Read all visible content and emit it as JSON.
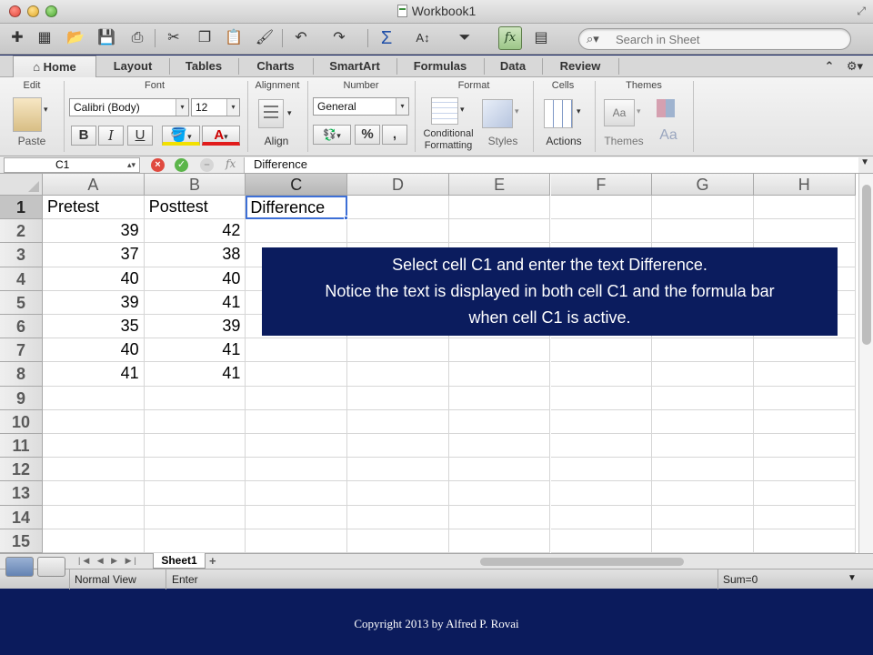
{
  "window": {
    "title": "Workbook1"
  },
  "search": {
    "placeholder": "Search in Sheet"
  },
  "tabs": [
    "Home",
    "Layout",
    "Tables",
    "Charts",
    "SmartArt",
    "Formulas",
    "Data",
    "Review"
  ],
  "ribbon": {
    "groups": [
      "Edit",
      "Font",
      "Alignment",
      "Number",
      "Format",
      "Cells",
      "Themes"
    ],
    "font_name": "Calibri (Body)",
    "font_size": "12",
    "number_format": "General",
    "paste_label": "Paste",
    "align_label": "Align",
    "conditional_formatting_label": "Conditional\nFormatting",
    "styles_label": "Styles",
    "actions_label": "Actions",
    "themes_label": "Themes",
    "bold": "B",
    "italic": "I",
    "underline": "U",
    "percent": "%",
    "comma": ","
  },
  "formula_bar": {
    "name_box": "C1",
    "fx": "fx",
    "content": "Difference"
  },
  "columns": [
    "A",
    "B",
    "C",
    "D",
    "E",
    "F",
    "G",
    "H"
  ],
  "rows": [
    "1",
    "2",
    "3",
    "4",
    "5",
    "6",
    "7",
    "8",
    "9",
    "10",
    "11",
    "12",
    "13",
    "14",
    "15"
  ],
  "cells": {
    "A1": "Pretest",
    "B1": "Posttest",
    "C1": "Difference",
    "A2": "39",
    "B2": "42",
    "A3": "37",
    "B3": "38",
    "A4": "40",
    "B4": "40",
    "A5": "39",
    "B5": "41",
    "A6": "35",
    "B6": "39",
    "A7": "40",
    "B7": "41",
    "A8": "41",
    "B8": "41"
  },
  "sheet_tab": "Sheet1",
  "status": {
    "view": "Normal View",
    "mode": "Enter",
    "sum": "Sum=0"
  },
  "callout": {
    "line1": "Select cell C1 and enter the text Difference.",
    "line2": "Notice the text is displayed in both cell C1 and the formula bar",
    "line3": "when cell C1 is active."
  },
  "footer": {
    "copyright": "Copyright 2013 by Alfred P. Rovai"
  },
  "colors": {
    "slide_bg": "#0b1b5c",
    "selection": "#3d6fd6",
    "callout_bg": "#0b1c5e"
  }
}
